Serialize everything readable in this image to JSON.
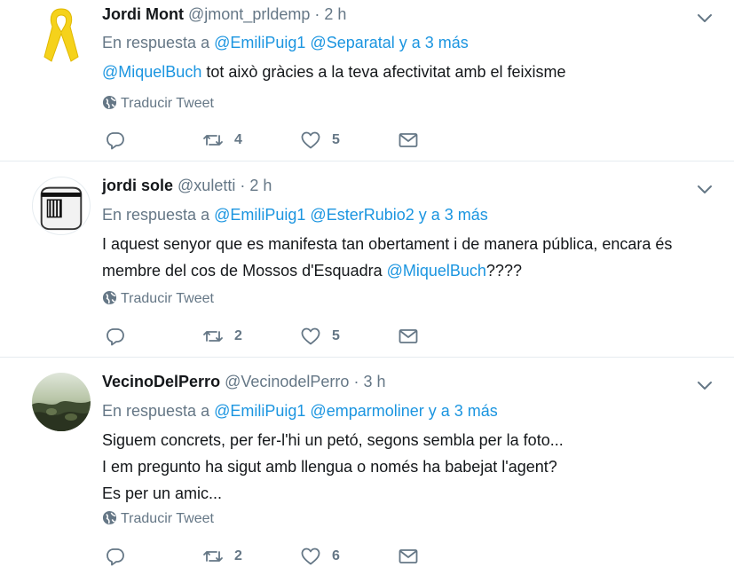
{
  "translate_label": "Traducir Tweet",
  "reply_prefix": "En respuesta a",
  "reply_connector": "y a 3 más",
  "colors": {
    "link": "#1b95e0",
    "muted": "#657786",
    "text": "#14171a",
    "ribbon": "#f5d21b"
  },
  "tweets": [
    {
      "name": "Jordi Mont",
      "handle": "@jmont_prldemp",
      "dot": "·",
      "time": "2 h",
      "reply_to": [
        "@EmiliPuig1",
        "@Separatal"
      ],
      "text_mention": "@MiquelBuch",
      "text": " tot això gràcies a la teva afectivitat amb el feixisme",
      "retweets": "4",
      "likes": "5",
      "avatar": "yellow-ribbon"
    },
    {
      "name": "jordi sole",
      "handle": "@xuletti",
      "dot": "·",
      "time": "2 h",
      "reply_to": [
        "@EmiliPuig1",
        "@EsterRubio2"
      ],
      "text_line1": "I aquest senyor que es manifesta tan obertament i de manera pública, encara és",
      "text_line2_pre": "membre del cos de Mossos d'Esquadra ",
      "text_mention": "@MiquelBuch",
      "text_line2_post": "????",
      "retweets": "2",
      "likes": "5",
      "avatar": "prison-box"
    },
    {
      "name": "VecinoDelPerro",
      "handle": "@VecinodelPerro",
      "dot": "·",
      "time": "3 h",
      "reply_to": [
        "@EmiliPuig1",
        "@emparmoliner"
      ],
      "lines": [
        "Siguem concrets, per fer-l'hi un petó, segons sembla per la foto...",
        "I em pregunto ha sigut amb llengua o només ha babejat l'agent?",
        "Es per un amic..."
      ],
      "retweets": "2",
      "likes": "6",
      "avatar": "photo"
    }
  ]
}
